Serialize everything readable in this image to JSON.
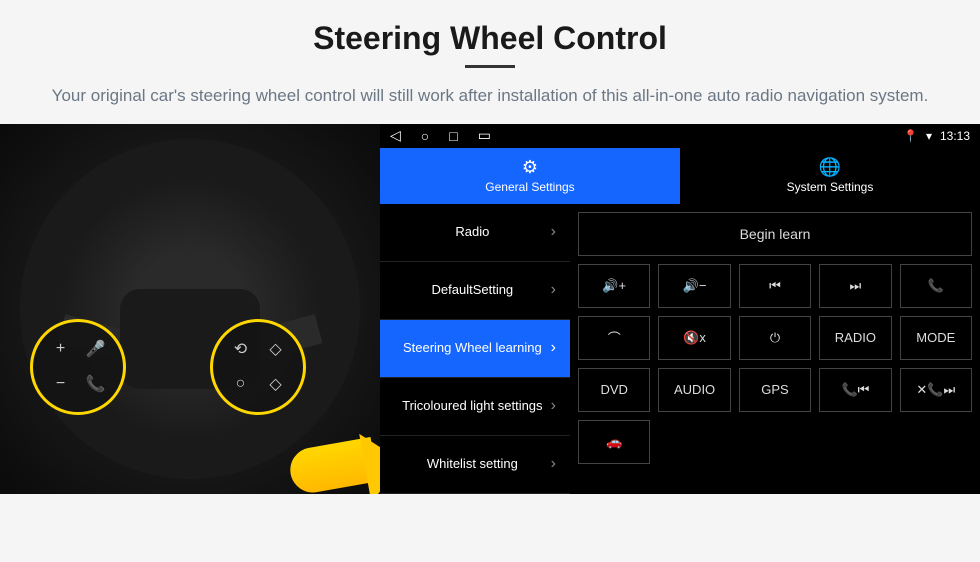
{
  "header": {
    "title": "Steering Wheel Control",
    "subtitle": "Your original car's steering wheel control will still work after installation of this all-in-one auto radio navigation system."
  },
  "status_bar": {
    "time": "13:13"
  },
  "tabs": {
    "general": "General Settings",
    "system": "System Settings"
  },
  "sidebar": {
    "items": [
      {
        "label": "Radio"
      },
      {
        "label": "DefaultSetting"
      },
      {
        "label": "Steering Wheel learning"
      },
      {
        "label": "Tricoloured light settings"
      },
      {
        "label": "Whitelist setting"
      }
    ]
  },
  "panel": {
    "begin_learn": "Begin learn",
    "buttons": {
      "vol_up": "vol+",
      "vol_down": "vol-",
      "prev": "prev",
      "next": "next",
      "call": "call",
      "hangup": "hangup",
      "mute": "mute",
      "power": "power",
      "radio": "RADIO",
      "mode": "MODE",
      "dvd": "DVD",
      "audio": "AUDIO",
      "gps": "GPS",
      "call_prev": "call-prev",
      "call_next": "call-next",
      "car": "car"
    }
  }
}
